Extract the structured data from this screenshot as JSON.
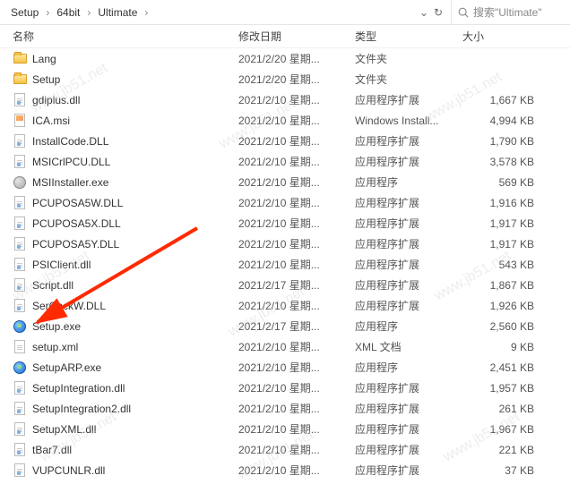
{
  "breadcrumb": {
    "items": [
      "Setup",
      "64bit",
      "Ultimate"
    ]
  },
  "search": {
    "placeholder": "搜索\"Ultimate\""
  },
  "columns": {
    "name": "名称",
    "date": "修改日期",
    "type": "类型",
    "size": "大小"
  },
  "rows": [
    {
      "icon": "folder",
      "name": "Lang",
      "date": "2021/2/20 星期...",
      "type": "文件夹",
      "size": ""
    },
    {
      "icon": "folder",
      "name": "Setup",
      "date": "2021/2/20 星期...",
      "type": "文件夹",
      "size": ""
    },
    {
      "icon": "dll",
      "name": "gdiplus.dll",
      "date": "2021/2/10 星期...",
      "type": "应用程序扩展",
      "size": "1,667 KB"
    },
    {
      "icon": "msi",
      "name": "ICA.msi",
      "date": "2021/2/10 星期...",
      "type": "Windows Install...",
      "size": "4,994 KB"
    },
    {
      "icon": "dll",
      "name": "InstallCode.DLL",
      "date": "2021/2/10 星期...",
      "type": "应用程序扩展",
      "size": "1,790 KB"
    },
    {
      "icon": "dll",
      "name": "MSICrlPCU.DLL",
      "date": "2021/2/10 星期...",
      "type": "应用程序扩展",
      "size": "3,578 KB"
    },
    {
      "icon": "exe",
      "name": "MSIInstaller.exe",
      "date": "2021/2/10 星期...",
      "type": "应用程序",
      "size": "569 KB"
    },
    {
      "icon": "dll",
      "name": "PCUPOSA5W.DLL",
      "date": "2021/2/10 星期...",
      "type": "应用程序扩展",
      "size": "1,916 KB"
    },
    {
      "icon": "dll",
      "name": "PCUPOSA5X.DLL",
      "date": "2021/2/10 星期...",
      "type": "应用程序扩展",
      "size": "1,917 KB"
    },
    {
      "icon": "dll",
      "name": "PCUPOSA5Y.DLL",
      "date": "2021/2/10 星期...",
      "type": "应用程序扩展",
      "size": "1,917 KB"
    },
    {
      "icon": "dll",
      "name": "PSIClient.dll",
      "date": "2021/2/10 星期...",
      "type": "应用程序扩展",
      "size": "543 KB"
    },
    {
      "icon": "dll",
      "name": "Script.dll",
      "date": "2021/2/17 星期...",
      "type": "应用程序扩展",
      "size": "1,867 KB"
    },
    {
      "icon": "dll",
      "name": "SerChckW.DLL",
      "date": "2021/2/10 星期...",
      "type": "应用程序扩展",
      "size": "1,926 KB"
    },
    {
      "icon": "globe",
      "name": "Setup.exe",
      "date": "2021/2/17 星期...",
      "type": "应用程序",
      "size": "2,560 KB"
    },
    {
      "icon": "xml",
      "name": "setup.xml",
      "date": "2021/2/10 星期...",
      "type": "XML 文档",
      "size": "9 KB"
    },
    {
      "icon": "globe",
      "name": "SetupARP.exe",
      "date": "2021/2/10 星期...",
      "type": "应用程序",
      "size": "2,451 KB"
    },
    {
      "icon": "dll",
      "name": "SetupIntegration.dll",
      "date": "2021/2/10 星期...",
      "type": "应用程序扩展",
      "size": "1,957 KB"
    },
    {
      "icon": "dll",
      "name": "SetupIntegration2.dll",
      "date": "2021/2/10 星期...",
      "type": "应用程序扩展",
      "size": "261 KB"
    },
    {
      "icon": "dll",
      "name": "SetupXML.dll",
      "date": "2021/2/10 星期...",
      "type": "应用程序扩展",
      "size": "1,967 KB"
    },
    {
      "icon": "dll",
      "name": "tBar7.dll",
      "date": "2021/2/10 星期...",
      "type": "应用程序扩展",
      "size": "221 KB"
    },
    {
      "icon": "dll",
      "name": "VUPCUNLR.dll",
      "date": "2021/2/10 星期...",
      "type": "应用程序扩展",
      "size": "37 KB"
    }
  ],
  "watermark": "www.jb51.net"
}
